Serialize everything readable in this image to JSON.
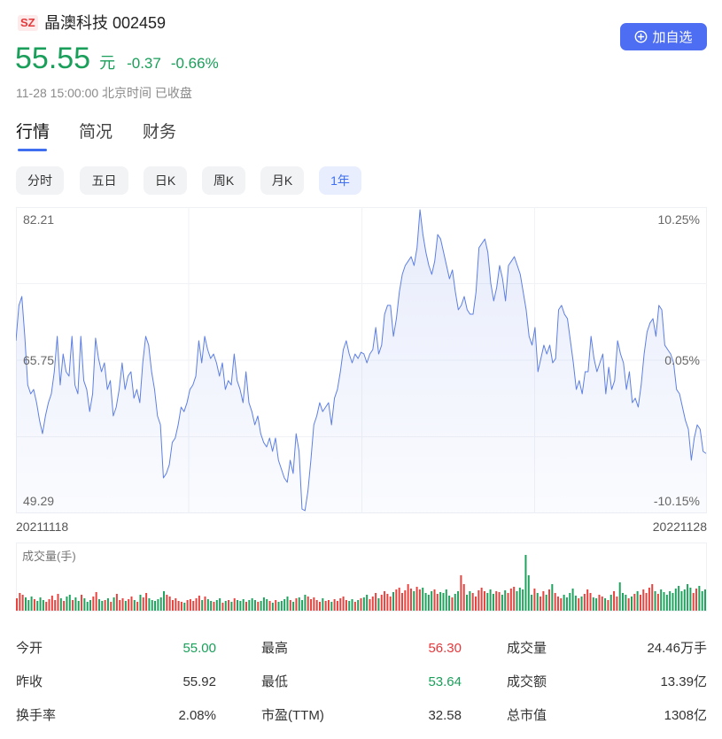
{
  "header": {
    "exchange_badge": "SZ",
    "stock_name": "晶澳科技",
    "stock_code": "002459",
    "watchlist_button_label": "加自选",
    "watchlist_icon": "plus-circle-icon"
  },
  "quote": {
    "price": "55.55",
    "currency_unit": "元",
    "change": "-0.37",
    "change_percent": "-0.66%",
    "timestamp": "11-28 15:00:00 北京时间 已收盘",
    "color": "#1a9f5a"
  },
  "tabs": [
    {
      "label": "行情",
      "active": true
    },
    {
      "label": "简况",
      "active": false
    },
    {
      "label": "财务",
      "active": false
    }
  ],
  "periods": [
    {
      "label": "分时",
      "active": false
    },
    {
      "label": "五日",
      "active": false
    },
    {
      "label": "日K",
      "active": false
    },
    {
      "label": "周K",
      "active": false
    },
    {
      "label": "月K",
      "active": false
    },
    {
      "label": "1年",
      "active": true
    }
  ],
  "stats": [
    [
      {
        "label": "今开",
        "value": "55.00",
        "color": "#1a9f5a"
      },
      {
        "label": "最高",
        "value": "56.30",
        "color": "#e5383b"
      },
      {
        "label": "成交量",
        "value": "24.46万手",
        "color": "#333333"
      }
    ],
    [
      {
        "label": "昨收",
        "value": "55.92",
        "color": "#333333"
      },
      {
        "label": "最低",
        "value": "53.64",
        "color": "#1a9f5a"
      },
      {
        "label": "成交额",
        "value": "13.39亿",
        "color": "#333333"
      }
    ],
    [
      {
        "label": "换手率",
        "value": "2.08%",
        "color": "#333333"
      },
      {
        "label": "市盈(TTM)",
        "value": "32.58",
        "color": "#333333"
      },
      {
        "label": "总市值",
        "value": "1308亿",
        "color": "#333333"
      }
    ]
  ],
  "colors": {
    "accent": "#4d6ef2",
    "line": "#5d7fe3",
    "up": "#e9433f",
    "down": "#20a35e",
    "grid": "#eef0f3"
  },
  "chart_data": [
    {
      "type": "line",
      "title": "",
      "ylim": [
        49.29,
        82.21
      ],
      "yticks_left": [
        "82.21",
        "65.75",
        "49.29"
      ],
      "yticks_right": [
        "10.25%",
        "0.05%",
        "-10.15%"
      ],
      "xticks": [
        "20211118",
        "20221128"
      ],
      "grid": true,
      "series": [
        {
          "values": [
            67.88,
            71.75,
            72.72,
            68.36,
            63.04,
            62.07,
            62.55,
            61.1,
            59.17,
            57.71,
            59.65,
            61.1,
            62.07,
            64.49,
            68.36,
            63.04,
            66.43,
            64.49,
            64.01,
            68.36,
            63.04,
            62.07,
            68.36,
            63.52,
            62.55,
            60.13,
            62.07,
            68.17,
            65.94,
            64.49,
            65.46,
            62.55,
            63.52,
            59.65,
            60.62,
            62.55,
            65.46,
            62.55,
            64.01,
            64.49,
            61.59,
            62.55,
            61.1,
            65.46,
            68.36,
            67.4,
            64.49,
            62.55,
            59.65,
            58.68,
            52.87,
            53.36,
            54.32,
            56.75,
            57.23,
            58.68,
            60.62,
            60.13,
            61.1,
            62.55,
            63.04,
            64.01,
            67.88,
            65.46,
            68.36,
            66.91,
            65.94,
            66.43,
            65.46,
            64.01,
            65.46,
            62.55,
            63.52,
            63.04,
            66.43,
            63.52,
            62.55,
            61.1,
            64.49,
            61.1,
            60.13,
            58.68,
            59.65,
            57.71,
            56.75,
            56.26,
            57.23,
            55.78,
            57.23,
            54.81,
            53.84,
            52.87,
            52.39,
            54.81,
            53.36,
            57.71,
            55.78,
            49.48,
            49.29,
            51.42,
            54.81,
            58.68,
            59.65,
            61.1,
            60.13,
            60.62,
            61.1,
            58.68,
            61.59,
            62.55,
            64.49,
            66.91,
            67.88,
            66.43,
            65.46,
            66.43,
            65.94,
            66.62,
            66.43,
            65.46,
            66.43,
            66.91,
            69.33,
            66.43,
            67.4,
            70.78,
            71.75,
            71.75,
            68.36,
            70.3,
            73.21,
            75.14,
            76.11,
            76.59,
            77.08,
            76.11,
            78.05,
            82.21,
            79.5,
            77.56,
            76.11,
            75.14,
            76.59,
            79.5,
            79.01,
            77.56,
            76.11,
            74.66,
            75.63,
            73.21,
            71.27,
            71.75,
            72.72,
            71.27,
            70.78,
            70.78,
            73.21,
            78.05,
            78.53,
            79.01,
            77.56,
            74.17,
            72.24,
            73.69,
            76.11,
            74.66,
            72.24,
            76.11,
            76.59,
            77.08,
            76.11,
            75.14,
            73.21,
            71.27,
            68.36,
            67.4,
            69.33,
            64.49,
            65.94,
            67.4,
            66.43,
            67.4,
            65.46,
            65.94,
            71.27,
            71.75,
            70.78,
            70.3,
            67.88,
            65.46,
            62.55,
            63.52,
            62.07,
            64.49,
            64.49,
            68.36,
            65.94,
            64.49,
            65.46,
            66.43,
            62.07,
            64.98,
            62.55,
            63.52,
            67.88,
            66.43,
            65.46,
            62.55,
            64.49,
            61.1,
            61.59,
            60.62,
            63.04,
            66.43,
            68.85,
            69.82,
            70.3,
            68.36,
            71.75,
            71.27,
            67.4,
            66.91,
            66.43,
            65.46,
            62.55,
            62.07,
            60.62,
            59.17,
            58.2,
            54.81,
            57.23,
            58.68,
            58.2,
            55.78,
            55.55
          ]
        }
      ]
    },
    {
      "type": "bar",
      "title": "成交量(手)",
      "grid": false,
      "values": [
        142800,
        204000,
        183600,
        153000,
        122400,
        163200,
        132600,
        112200,
        153000,
        122400,
        102000,
        132600,
        173400,
        122400,
        193800,
        142800,
        112200,
        163200,
        183600,
        122400,
        153000,
        112200,
        183600,
        142800,
        102000,
        122400,
        163200,
        214200,
        132600,
        112200,
        122400,
        142800,
        102000,
        153000,
        193800,
        122400,
        142800,
        112200,
        132600,
        163200,
        122400,
        102000,
        183600,
        153000,
        204000,
        142800,
        122400,
        112200,
        132600,
        153000,
        224400,
        183600,
        163200,
        122400,
        142800,
        112200,
        102000,
        91800,
        122400,
        132600,
        112200,
        142800,
        173400,
        122400,
        163200,
        132600,
        112200,
        102000,
        122400,
        142800,
        91800,
        112200,
        122400,
        102000,
        142800,
        122400,
        112200,
        132600,
        102000,
        122400,
        142800,
        122400,
        102000,
        112200,
        153000,
        132600,
        112200,
        91800,
        122400,
        102000,
        112200,
        132600,
        163200,
        122400,
        102000,
        142800,
        153000,
        122400,
        183600,
        163200,
        132600,
        153000,
        122400,
        102000,
        142800,
        112200,
        122400,
        102000,
        132600,
        112200,
        142800,
        163200,
        122400,
        112200,
        132600,
        102000,
        122400,
        142800,
        153000,
        183600,
        132600,
        163200,
        204000,
        142800,
        183600,
        224400,
        193800,
        163200,
        214200,
        244800,
        265200,
        204000,
        234600,
        306000,
        255000,
        224400,
        275400,
        244800,
        265200,
        204000,
        183600,
        224400,
        244800,
        193800,
        214200,
        204000,
        244800,
        173400,
        153000,
        193800,
        224400,
        408000,
        306000,
        183600,
        224400,
        204000,
        163200,
        234600,
        265200,
        224400,
        204000,
        244800,
        193800,
        224400,
        214200,
        183600,
        234600,
        204000,
        255000,
        275400,
        224400,
        265200,
        244800,
        642600,
        408000,
        183600,
        255000,
        204000,
        163200,
        224400,
        183600,
        244800,
        306000,
        204000,
        163200,
        142800,
        183600,
        153000,
        204000,
        255000,
        173400,
        142800,
        163200,
        193800,
        244800,
        204000,
        153000,
        142800,
        183600,
        163200,
        142800,
        122400,
        183600,
        224400,
        163200,
        326400,
        204000,
        183600,
        142800,
        163200,
        193800,
        224400,
        183600,
        244800,
        204000,
        265200,
        306000,
        224400,
        193800,
        244800,
        214200,
        183600,
        224400,
        204000,
        255000,
        285600,
        224400,
        244800,
        306000,
        265200,
        204000,
        255000,
        285600,
        224400,
        244600
      ]
    }
  ]
}
